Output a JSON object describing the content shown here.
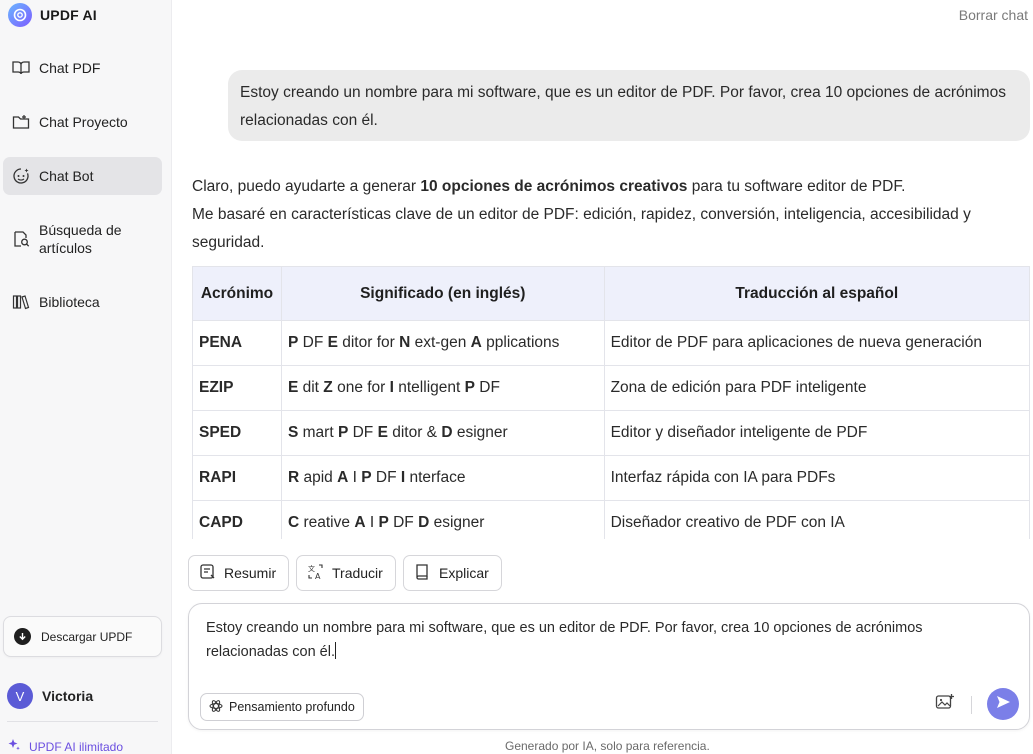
{
  "app": {
    "name": "UPDF AI"
  },
  "sidebar": {
    "items": [
      {
        "label": "Chat PDF",
        "icon": "book-open-icon"
      },
      {
        "label": "Chat Proyecto",
        "icon": "folder-icon"
      },
      {
        "label": "Chat Bot",
        "icon": "bot-icon",
        "active": true
      },
      {
        "label": "Búsqueda de artículos",
        "icon": "search-doc-icon"
      },
      {
        "label": "Biblioteca",
        "icon": "library-icon"
      }
    ],
    "download_label": "Descargar UPDF",
    "user": {
      "initial": "V",
      "name": "Victoria"
    },
    "unlimited_label": "UPDF AI ilimitado"
  },
  "header": {
    "clear_label": "Borrar chat"
  },
  "conversation": {
    "user_message": "Estoy creando un nombre para mi software, que es un editor de PDF. Por favor, crea 10 opciones de acrónimos relacionadas con él.",
    "answer": {
      "intro_prefix": "Claro, puedo ayudarte a generar ",
      "intro_bold": "10 opciones de acrónimos creativos",
      "intro_suffix": " para tu software editor de PDF.",
      "line2": "Me basaré en características clave de un editor de PDF: edición, rapidez, conversión, inteligencia, accesibilidad y seguridad."
    },
    "table": {
      "headers": [
        "Acrónimo",
        "Significado (en inglés)",
        "Traducción al español"
      ],
      "rows": [
        {
          "acronym": "PENA",
          "meaning": [
            [
              "P",
              " DF "
            ],
            [
              "E",
              " ditor for "
            ],
            [
              "N",
              " ext-gen "
            ],
            [
              "A",
              " pplications"
            ]
          ],
          "translation": "Editor de PDF para aplicaciones de nueva generación"
        },
        {
          "acronym": "EZIP",
          "meaning": [
            [
              "E",
              " dit "
            ],
            [
              "Z",
              " one for "
            ],
            [
              "I",
              " ntelligent "
            ],
            [
              "P",
              " DF"
            ]
          ],
          "translation": "Zona de edición para PDF inteligente"
        },
        {
          "acronym": "SPED",
          "meaning": [
            [
              "S",
              " mart "
            ],
            [
              "P",
              " DF "
            ],
            [
              "E",
              " ditor & "
            ],
            [
              "D",
              " esigner"
            ]
          ],
          "translation": "Editor y diseñador inteligente de PDF"
        },
        {
          "acronym": "RAPI",
          "meaning": [
            [
              "R",
              " apid "
            ],
            [
              "A",
              " I "
            ],
            [
              "P",
              " DF "
            ],
            [
              "I",
              " nterface"
            ]
          ],
          "translation": "Interfaz rápida con IA para PDFs"
        },
        {
          "acronym": "CAPD",
          "meaning": [
            [
              "C",
              " reative "
            ],
            [
              "A",
              " I "
            ],
            [
              "P",
              " DF "
            ],
            [
              "D",
              " esigner"
            ]
          ],
          "translation": "Diseñador creativo de PDF con IA"
        }
      ]
    }
  },
  "actions": [
    "Resumir",
    "Traducir",
    "Explicar"
  ],
  "composer": {
    "text": "Estoy creando un nombre para mi software, que es un editor de PDF. Por favor, crea 10 opciones de acrónimos relacionadas con él.",
    "deep_think_label": "Pensamiento profundo"
  },
  "footer": {
    "note": "Generado por IA, solo para referencia."
  },
  "colors": {
    "accent": "#7b7fe8",
    "brand_purple": "#6b4fe0",
    "table_header": "#eef0fb"
  }
}
